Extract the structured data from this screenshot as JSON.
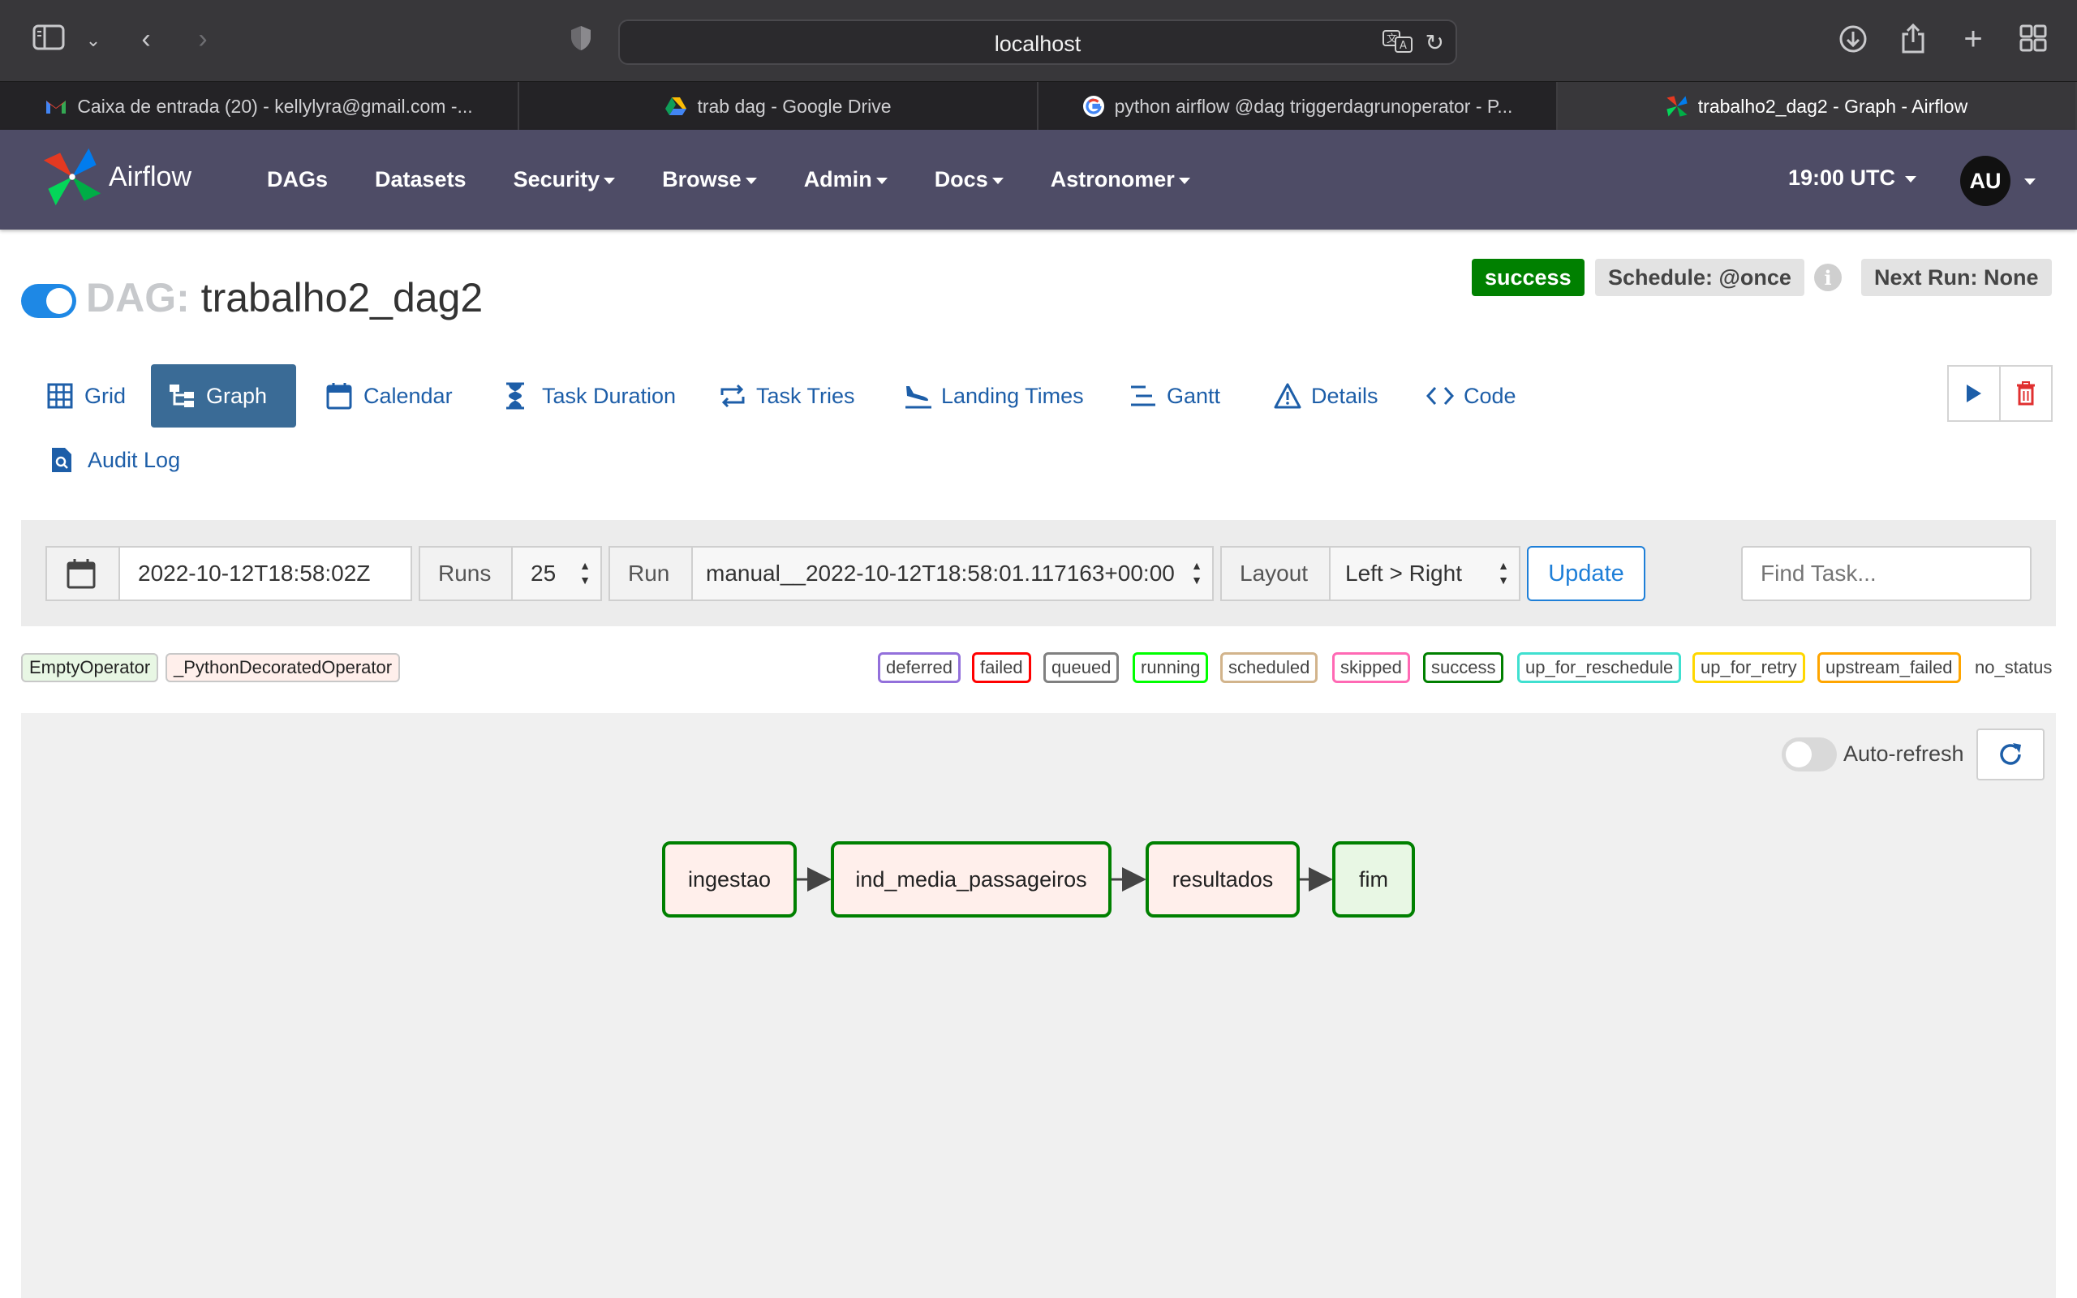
{
  "browser": {
    "url": "localhost",
    "tabs": [
      {
        "title": "Caixa de entrada (20) - kellylyra@gmail.com -...",
        "favicon": "gmail-icon"
      },
      {
        "title": "trab dag - Google Drive",
        "favicon": "google-drive-icon"
      },
      {
        "title": "python airflow @dag triggerdagrunoperator - P...",
        "favicon": "google-icon"
      },
      {
        "title": "trabalho2_dag2 - Graph - Airflow",
        "favicon": "airflow-icon"
      }
    ],
    "active_tab": 3
  },
  "navbar": {
    "brand": "Airflow",
    "links": [
      {
        "label": "DAGs",
        "dropdown": false
      },
      {
        "label": "Datasets",
        "dropdown": false
      },
      {
        "label": "Security",
        "dropdown": true
      },
      {
        "label": "Browse",
        "dropdown": true
      },
      {
        "label": "Admin",
        "dropdown": true
      },
      {
        "label": "Docs",
        "dropdown": true
      },
      {
        "label": "Astronomer",
        "dropdown": true
      }
    ],
    "clock": "19:00 UTC",
    "user_initials": "AU"
  },
  "dag": {
    "prefix": "DAG:",
    "name": "trabalho2_dag2",
    "paused": false,
    "state": "success",
    "schedule": "Schedule: @once",
    "next_run": "Next Run: None"
  },
  "views": {
    "active": "Graph",
    "tabs": [
      {
        "label": "Grid",
        "icon": "grid-icon"
      },
      {
        "label": "Graph",
        "icon": "graph-icon"
      },
      {
        "label": "Calendar",
        "icon": "calendar-icon"
      },
      {
        "label": "Task Duration",
        "icon": "hourglass-icon"
      },
      {
        "label": "Task Tries",
        "icon": "repeat-icon"
      },
      {
        "label": "Landing Times",
        "icon": "plane-landing-icon"
      },
      {
        "label": "Gantt",
        "icon": "gantt-icon"
      },
      {
        "label": "Details",
        "icon": "warning-triangle-icon"
      },
      {
        "label": "Code",
        "icon": "code-icon"
      },
      {
        "label": "Audit Log",
        "icon": "file-search-icon"
      }
    ]
  },
  "filters": {
    "base_date": "2022-10-12T18:58:02Z",
    "runs_label": "Runs",
    "runs_value": "25",
    "run_label": "Run",
    "run_value": "manual__2022-10-12T18:58:01.117163+00:00",
    "layout_label": "Layout",
    "layout_value": "Left > Right",
    "update_label": "Update",
    "find_placeholder": "Find Task..."
  },
  "operator_legend": [
    {
      "label": "EmptyOperator",
      "color": "#e8f7e4"
    },
    {
      "label": "_PythonDecoratedOperator",
      "color": "#ffefeb"
    }
  ],
  "state_legend": [
    {
      "label": "deferred",
      "color": "#9370db"
    },
    {
      "label": "failed",
      "color": "#ff0000"
    },
    {
      "label": "queued",
      "color": "#808080"
    },
    {
      "label": "running",
      "color": "#00ff00"
    },
    {
      "label": "scheduled",
      "color": "#d2b48c"
    },
    {
      "label": "skipped",
      "color": "#ff69b4"
    },
    {
      "label": "success",
      "color": "#008000"
    },
    {
      "label": "up_for_reschedule",
      "color": "#40e0d0"
    },
    {
      "label": "up_for_retry",
      "color": "#ffd700"
    },
    {
      "label": "upstream_failed",
      "color": "#ffa500"
    },
    {
      "label": "no_status",
      "color": ""
    }
  ],
  "graph": {
    "auto_refresh_label": "Auto-refresh",
    "auto_refresh": false,
    "nodes": [
      {
        "id": "ingestao",
        "operator": "_PythonDecoratedOperator",
        "state": "success"
      },
      {
        "id": "ind_media_passageiros",
        "operator": "_PythonDecoratedOperator",
        "state": "success"
      },
      {
        "id": "resultados",
        "operator": "_PythonDecoratedOperator",
        "state": "success"
      },
      {
        "id": "fim",
        "operator": "EmptyOperator",
        "state": "success"
      }
    ],
    "edges": [
      [
        "ingestao",
        "ind_media_passageiros"
      ],
      [
        "ind_media_passageiros",
        "resultados"
      ],
      [
        "resultados",
        "fim"
      ]
    ]
  }
}
